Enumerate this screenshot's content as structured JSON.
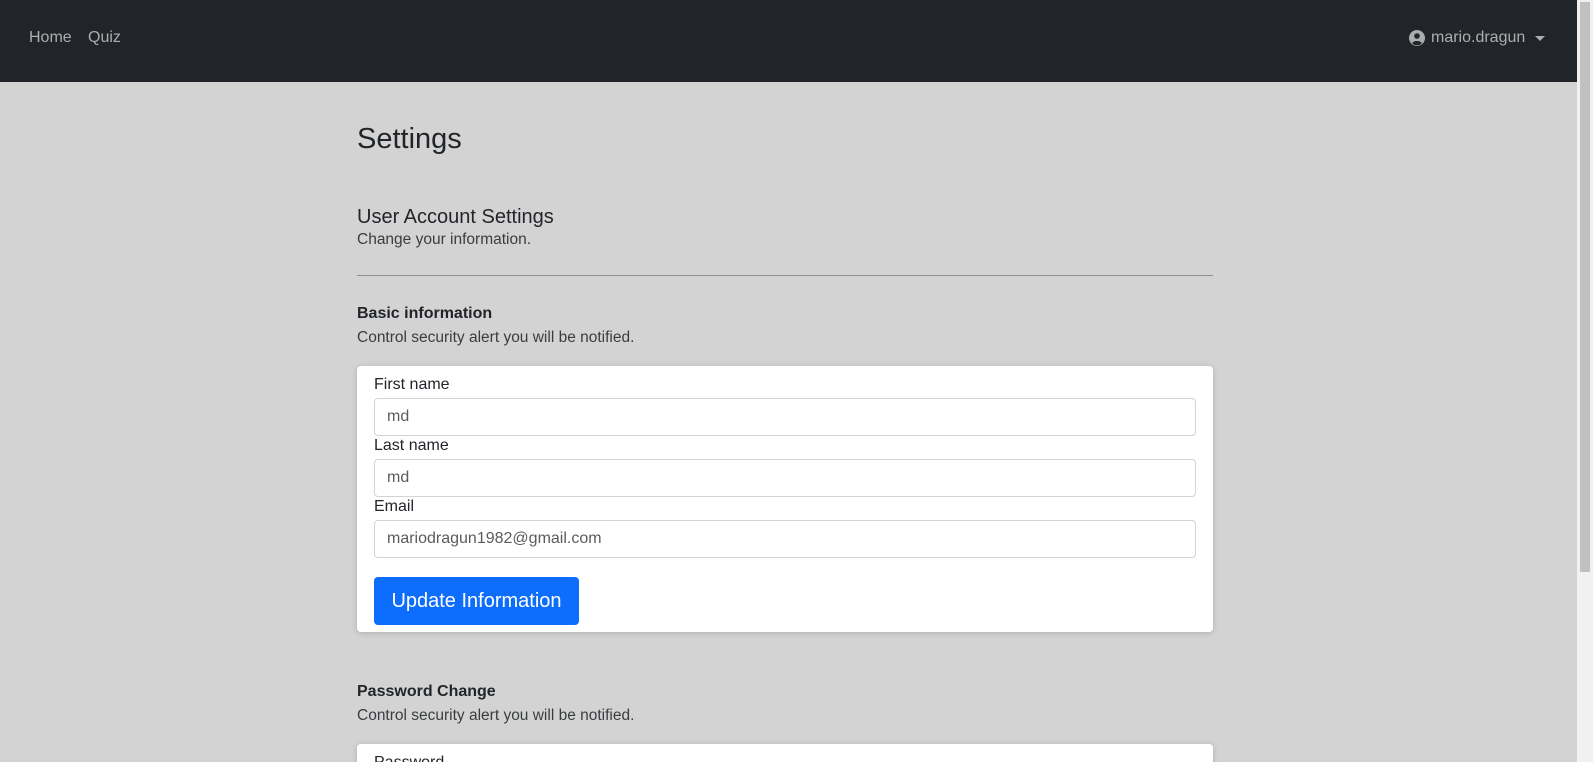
{
  "navbar": {
    "home_label": "Home",
    "quiz_label": "Quiz",
    "username": "mario.dragun"
  },
  "page": {
    "title": "Settings"
  },
  "account_section": {
    "title": "User Account Settings",
    "subtitle": "Change your information."
  },
  "basic_info": {
    "title": "Basic information",
    "subtitle": "Control security alert you will be notified.",
    "first_name_label": "First name",
    "first_name_value": "md",
    "last_name_label": "Last name",
    "last_name_value": "md",
    "email_label": "Email",
    "email_value": "mariodragun1982@gmail.com",
    "submit_label": "Update Information"
  },
  "password_change": {
    "title": "Password Change",
    "subtitle": "Control security alert you will be notified.",
    "password_label": "Password"
  },
  "colors": {
    "navbar_bg": "#212529",
    "page_bg": "#d3d3d3",
    "primary": "#0d6efd"
  },
  "icons": {
    "user": "user-circle-icon",
    "dropdown": "caret-down-icon"
  }
}
